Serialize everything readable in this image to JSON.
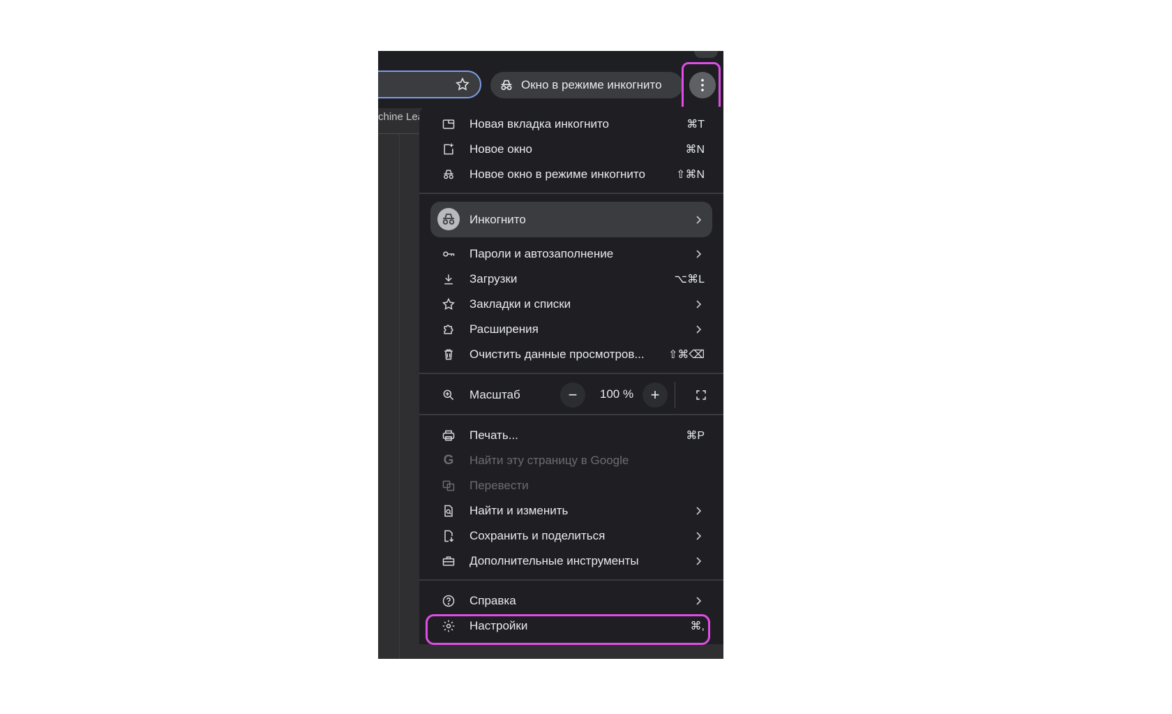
{
  "toolbar": {
    "incognito_pill": "Окно в режиме инкогнито",
    "bookmark_fragment": "chine Lea"
  },
  "menu": {
    "group1": [
      {
        "label": "Новая вкладка инкогнито",
        "shortcut": "⌘T",
        "icon": "new-tab-icon"
      },
      {
        "label": "Новое окно",
        "shortcut": "⌘N",
        "icon": "new-window-icon"
      },
      {
        "label": "Новое окно в режиме инкогнито",
        "shortcut": "⇧⌘N",
        "icon": "incognito-icon"
      }
    ],
    "profile": {
      "label": "Инкогнито",
      "icon": "incognito-avatar-icon"
    },
    "group2": [
      {
        "label": "Пароли и автозаполнение",
        "icon": "key-icon",
        "submenu": true
      },
      {
        "label": "Загрузки",
        "shortcut": "⌥⌘L",
        "icon": "download-icon"
      },
      {
        "label": "Закладки и списки",
        "icon": "star-icon",
        "submenu": true
      },
      {
        "label": "Расширения",
        "icon": "puzzle-icon",
        "submenu": true
      },
      {
        "label": "Очистить данные просмотров...",
        "shortcut": "⇧⌘⌫",
        "icon": "trash-icon"
      }
    ],
    "zoom": {
      "label": "Масштаб",
      "value": "100 %",
      "minus": "−",
      "plus": "+"
    },
    "group3": [
      {
        "label": "Печать...",
        "shortcut": "⌘P",
        "icon": "printer-icon"
      },
      {
        "label": "Найти эту страницу в Google",
        "icon": "google-icon",
        "disabled": true
      },
      {
        "label": "Перевести",
        "icon": "translate-icon",
        "disabled": true
      },
      {
        "label": "Найти и изменить",
        "icon": "find-icon",
        "submenu": true
      },
      {
        "label": "Сохранить и поделиться",
        "icon": "save-share-icon",
        "submenu": true
      },
      {
        "label": "Дополнительные инструменты",
        "icon": "toolbox-icon",
        "submenu": true
      }
    ],
    "group4": [
      {
        "label": "Справка",
        "icon": "help-icon",
        "submenu": true
      },
      {
        "label": "Настройки",
        "shortcut": "⌘,",
        "icon": "settings-gear-icon"
      }
    ]
  },
  "colors": {
    "highlight": "#e14ce8",
    "menu_bg": "#1f1f23",
    "accent": "#7b9ee8"
  }
}
